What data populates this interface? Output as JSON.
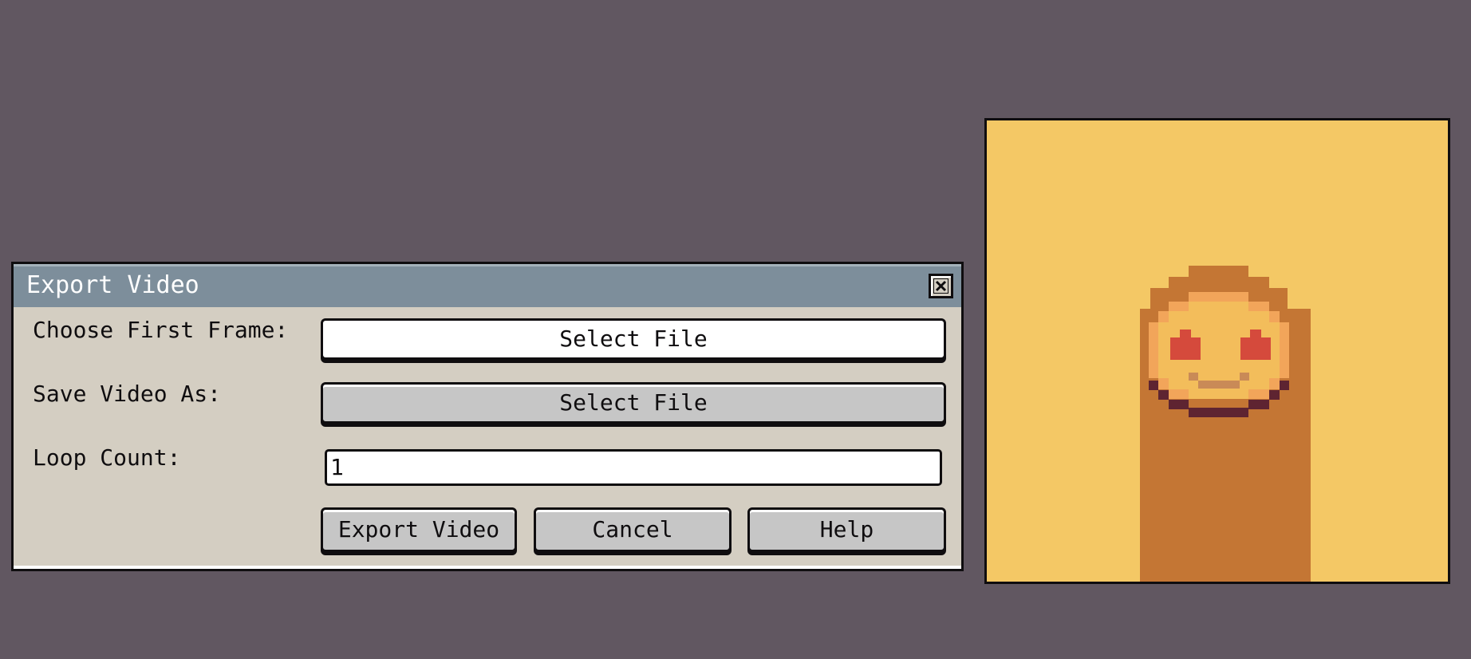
{
  "dialog": {
    "title": "Export Video",
    "close_icon": "close-x-icon",
    "first_frame_label": "Choose First Frame:",
    "first_frame_button": "Select File",
    "save_as_label": "Save Video As:",
    "save_as_button": "Select File",
    "loop_count_label": "Loop Count:",
    "loop_count_value": "1",
    "export_button": "Export Video",
    "cancel_button": "Cancel",
    "help_button": "Help"
  },
  "preview": {
    "image": "pixel-smiley-character-icon",
    "colors": {
      "background": "#f4c865",
      "body": "#c47634",
      "face": "#f3bd5b",
      "face_rim": "#f2a55a",
      "eyes": "#d54a3c",
      "mouth": "#c98a57",
      "shadow": "#5e2431"
    }
  },
  "colors": {
    "desktop": "#615761",
    "titlebar": "#7d8e9b",
    "dialog_body": "#d4cec2"
  }
}
